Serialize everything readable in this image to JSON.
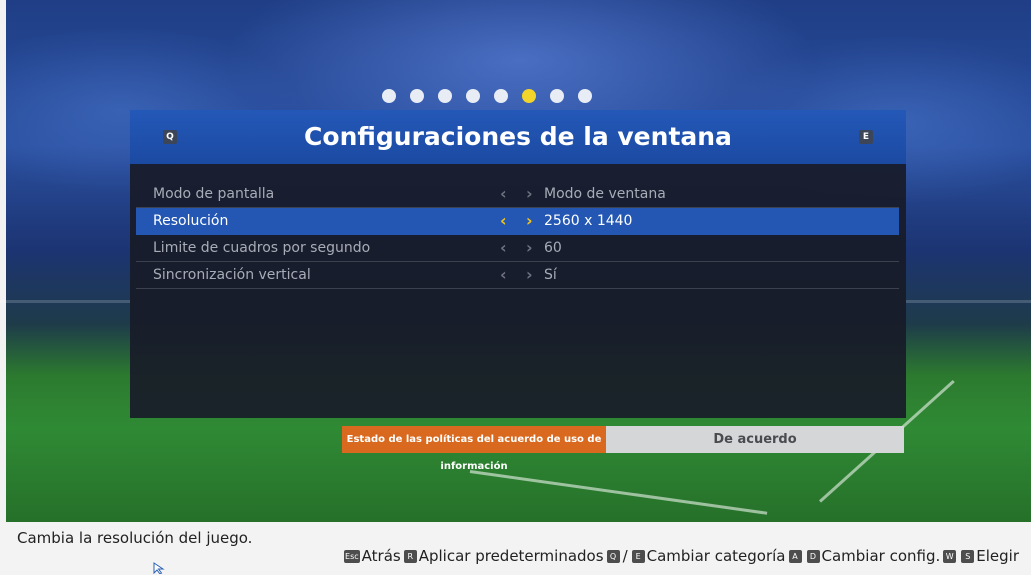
{
  "pagination": {
    "total": 8,
    "active_index": 5
  },
  "panel": {
    "title": "Configuraciones de la ventana",
    "prev_key": "Q",
    "next_key": "E"
  },
  "settings": [
    {
      "label": "Modo de pantalla",
      "value": "Modo de ventana",
      "selected": false
    },
    {
      "label": "Resolución",
      "value": "2560 x 1440",
      "selected": true
    },
    {
      "label": "Limite de cuadros por segundo",
      "value": "60",
      "selected": false
    },
    {
      "label": "Sincronización vertical",
      "value": "Sí",
      "selected": false
    }
  ],
  "policy": {
    "label": "Estado de las políticas del acuerdo de uso de información",
    "value": "De acuerdo"
  },
  "footer": {
    "description": "Cambia la resolución del juego.",
    "hints": {
      "back_key": "Esc",
      "back_label": "Atrás",
      "defaults_key": "R",
      "defaults_label": "Aplicar predeterminados",
      "category_key_1": "Q",
      "category_sep": "/",
      "category_key_2": "E",
      "category_label": "Cambiar categoría",
      "config_key_1": "A",
      "config_key_2": "D",
      "config_label": "Cambiar config.",
      "choose_key_1": "W",
      "choose_key_2": "S",
      "choose_label": "Elegir"
    }
  },
  "colors": {
    "accent_yellow": "#f4c51d",
    "header_blue": "#1b4aa2",
    "selected_row": "#2357b3",
    "policy_orange": "#d9691e"
  }
}
